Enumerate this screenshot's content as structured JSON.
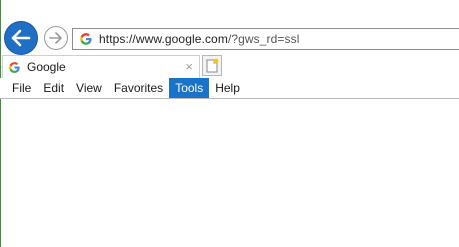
{
  "browser": {
    "address_bar": {
      "url_main": "https://www.google.com",
      "url_rest": "/?gws_rd=ssl"
    },
    "tab": {
      "title": "Google",
      "close_glyph": "×"
    },
    "menu": {
      "items": [
        "File",
        "Edit",
        "View",
        "Favorites",
        "Tools",
        "Help"
      ],
      "active_item": "Tools"
    },
    "colors": {
      "back_button": "#1f6fc5",
      "menu_active": "#1a73c9"
    },
    "icons": {
      "back": "back-arrow-icon",
      "forward": "forward-arrow-icon",
      "favicon": "google-g-icon",
      "new_tab": "new-tab-icon"
    }
  }
}
